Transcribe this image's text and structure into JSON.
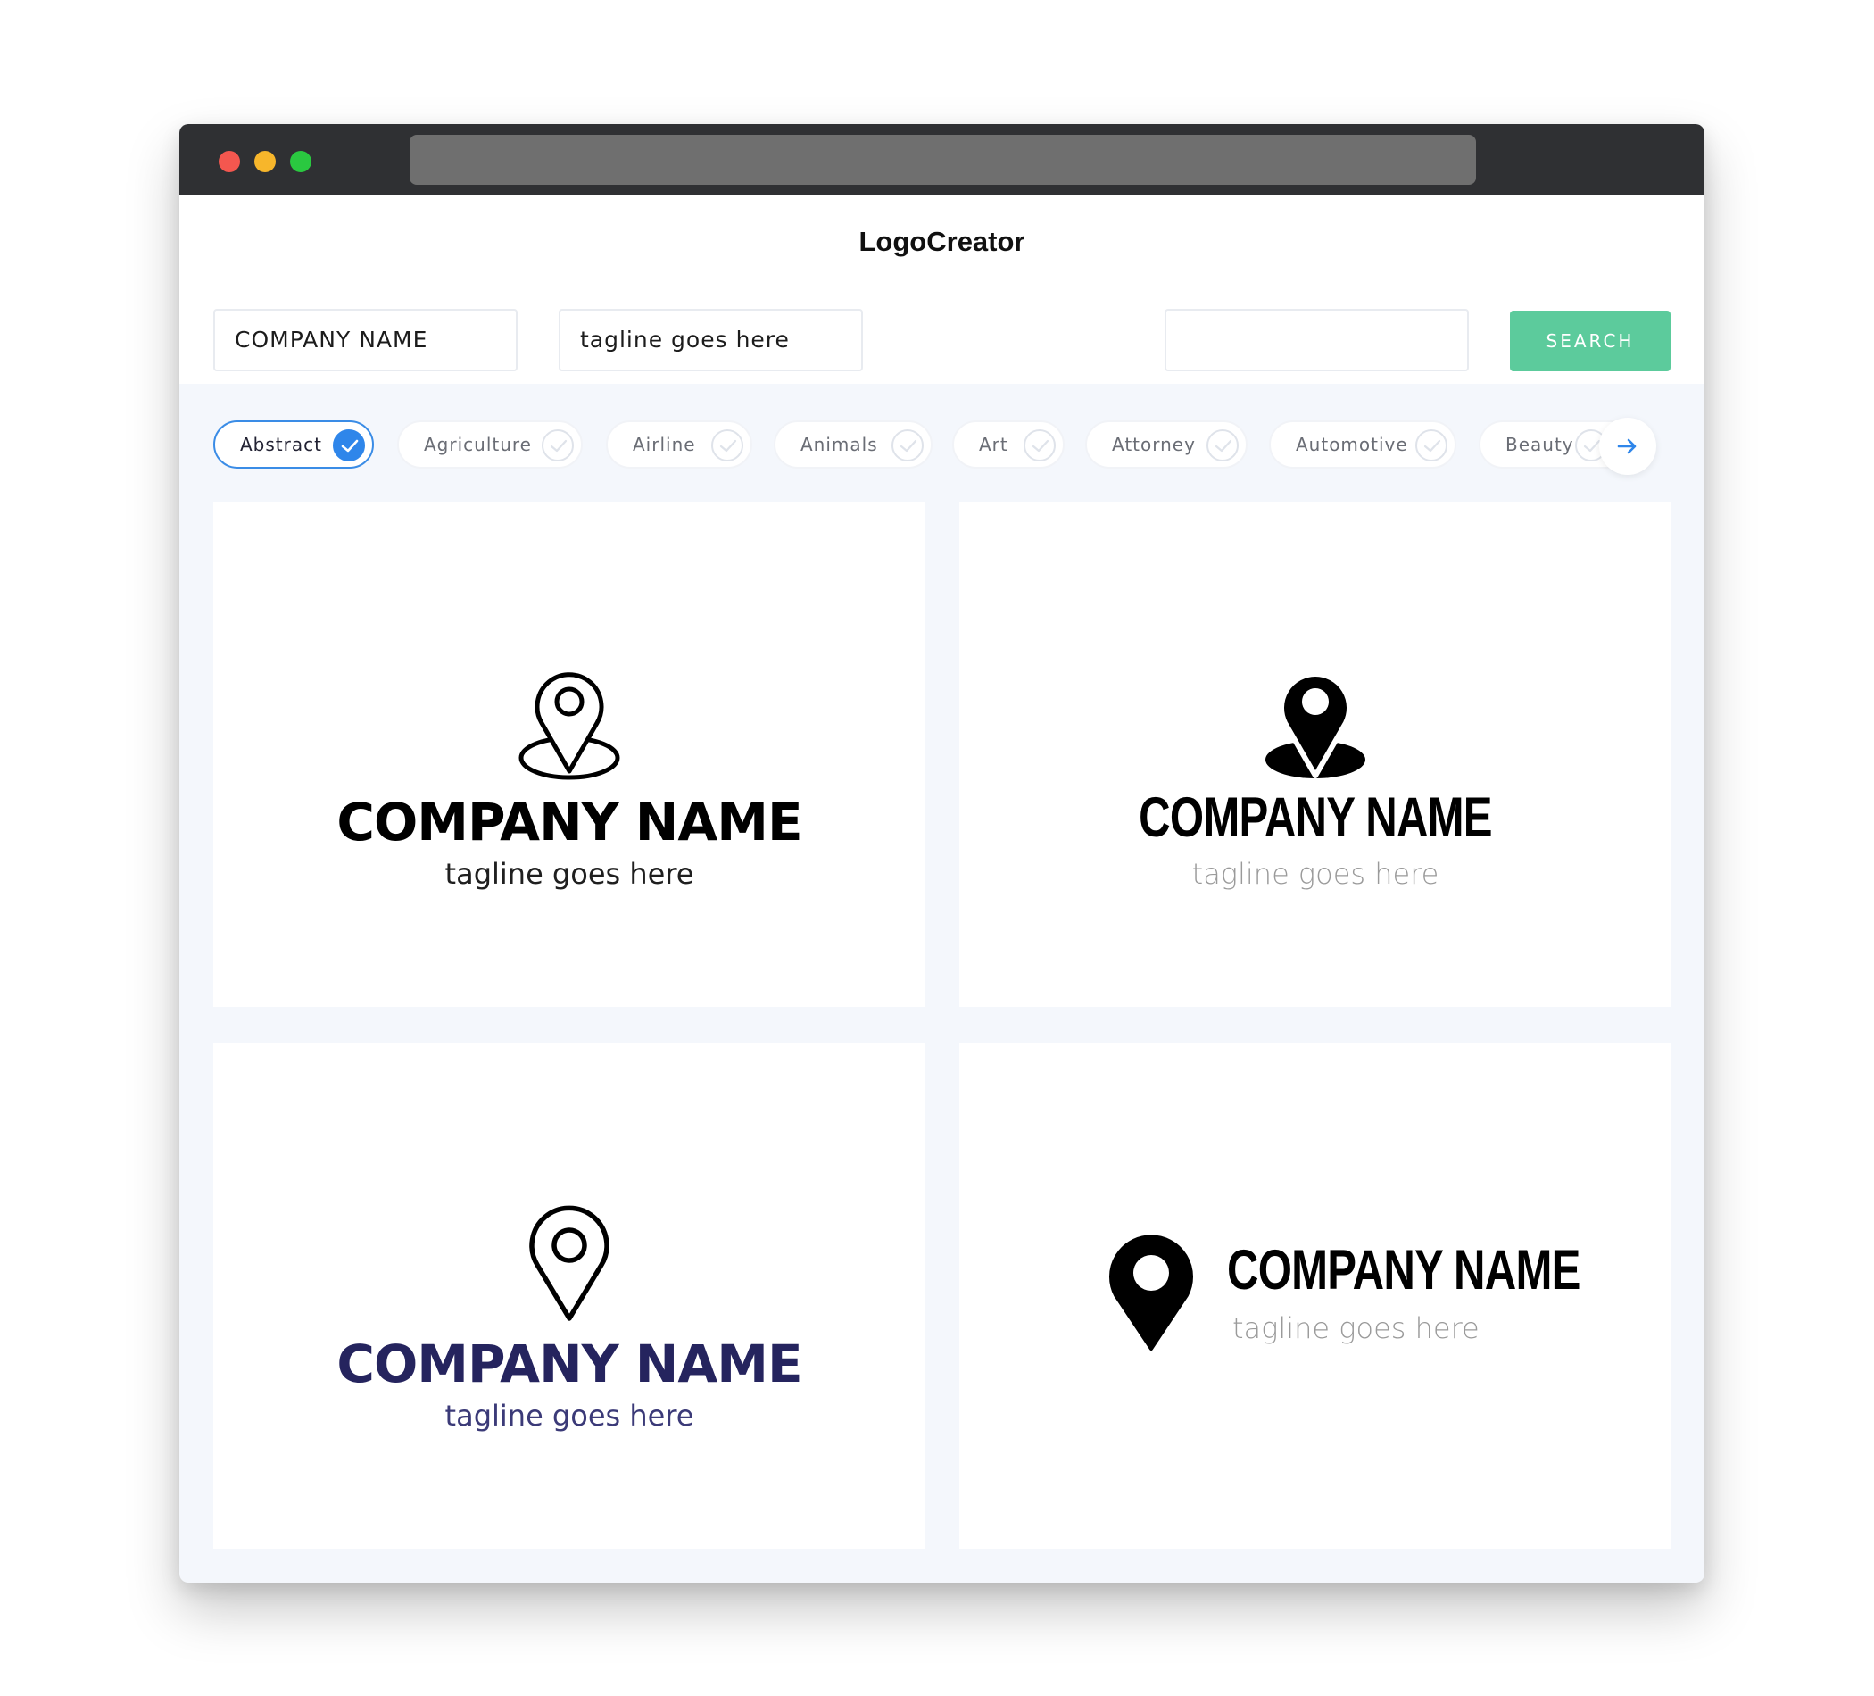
{
  "app": {
    "brand": "LogoCreator"
  },
  "search": {
    "company_value": "COMPANY NAME",
    "tagline_value": "tagline goes here",
    "keyword_value": "",
    "button_label": "SEARCH"
  },
  "categories": [
    {
      "label": "Abstract",
      "selected": true
    },
    {
      "label": "Agriculture",
      "selected": false
    },
    {
      "label": "Airline",
      "selected": false
    },
    {
      "label": "Animals",
      "selected": false
    },
    {
      "label": "Art",
      "selected": false
    },
    {
      "label": "Attorney",
      "selected": false
    },
    {
      "label": "Automotive",
      "selected": false
    },
    {
      "label": "Beauty",
      "selected": false
    }
  ],
  "logos": [
    {
      "name": "COMPANY NAME",
      "tagline": "tagline goes here",
      "icon": "location-pin-outline-icon",
      "color": "#000000"
    },
    {
      "name": "COMPANY NAME",
      "tagline": "tagline goes here",
      "icon": "location-pin-solid-icon",
      "color": "#000000"
    },
    {
      "name": "COMPANY NAME",
      "tagline": "tagline goes here",
      "icon": "location-pin-outline-icon",
      "color": "#25245e"
    },
    {
      "name": "COMPANY NAME",
      "tagline": "tagline goes here",
      "icon": "location-pin-solid-icon",
      "color": "#000000"
    }
  ],
  "colors": {
    "accent": "#5ccb9c",
    "selected_chip": "#2f86ea",
    "navy": "#25245e"
  }
}
